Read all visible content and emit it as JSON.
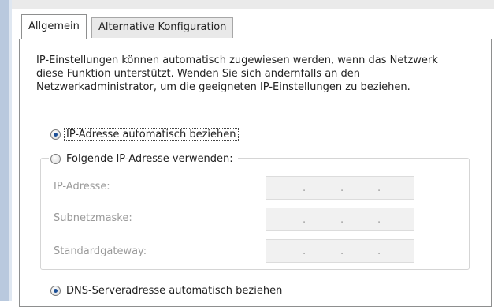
{
  "tabs": [
    {
      "label": "Allgemein",
      "active": true
    },
    {
      "label": "Alternative Konfiguration",
      "active": false
    }
  ],
  "description": "IP-Einstellungen können automatisch zugewiesen werden, wenn das Netzwerk diese Funktion unterstützt. Wenden Sie sich andernfalls an den Netzwerkadministrator, um die geeigneten IP-Einstellungen zu beziehen.",
  "radios": {
    "ip_auto": {
      "label": "IP-Adresse automatisch beziehen",
      "checked": true
    },
    "ip_manual": {
      "label": "Folgende IP-Adresse verwenden:",
      "checked": false
    },
    "dns_auto": {
      "label": "DNS-Serveradresse automatisch beziehen",
      "checked": true
    }
  },
  "fields": [
    {
      "label": "IP-Adresse:",
      "value": ""
    },
    {
      "label": "Subnetzmaske:",
      "value": ""
    },
    {
      "label": "Standardgateway:",
      "value": ""
    }
  ],
  "ip_separator": ".",
  "colors": {
    "radio_dot": "#1c4f96",
    "disabled_text": "#9a9a9a",
    "disabled_field": "#f1f1f1"
  }
}
